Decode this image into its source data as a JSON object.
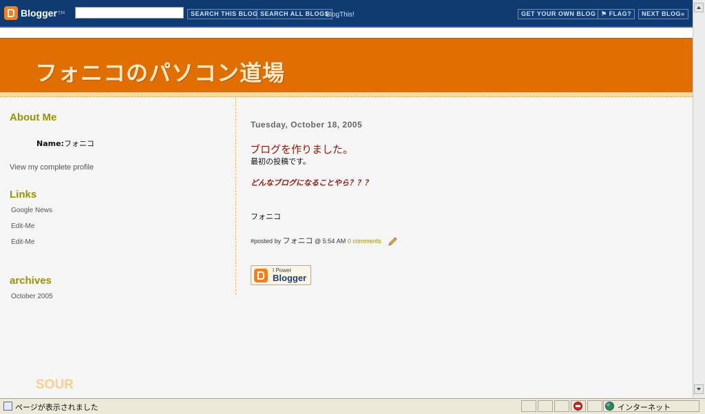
{
  "navbar": {
    "logo_text": "Blogger",
    "logo_tm": "TM",
    "search_value": "",
    "search_this_blog": "SEARCH THIS BLOG",
    "search_all_blogs": "SEARCH ALL BLOGS",
    "blogthis": "BlogThis!",
    "get_your_own": "GET YOUR OWN BLOG",
    "flag": "FLAG?",
    "next_blog": "NEXT BLOG»"
  },
  "header": {
    "title": "フォニコのパソコン道場"
  },
  "sidebar": {
    "about_heading": "About Me",
    "name_label": "Name:",
    "name_value": "フォニコ",
    "profile_link": "View my complete profile",
    "links_heading": "Links",
    "links": [
      "Google News",
      "Edit-Me",
      "Edit-Me"
    ],
    "archives_heading": "archives",
    "archives": [
      "October 2005"
    ]
  },
  "post": {
    "date": "Tuesday, October 18, 2005",
    "title": "ブログを作りました。",
    "body": "最初の投稿です。",
    "emphasis": "どんなブログになることやら？？？",
    "signature": "フォニコ",
    "hash": "#",
    "posted_by": "posted by ",
    "author": "フォニコ",
    "at": " @ 5:54 AM ",
    "comments": "0 comments"
  },
  "powered": {
    "small": "I Power",
    "big": "Blogger"
  },
  "footer_text": "SOUR",
  "statusbar": {
    "message": "ページが表示されました",
    "zone": "インターネット"
  },
  "colors": {
    "navbar_bg": "#103a72",
    "header_bg": "#e06e00",
    "header_title": "#ffe9c7",
    "heading": "#999300",
    "post_title": "#8b1a0b"
  }
}
